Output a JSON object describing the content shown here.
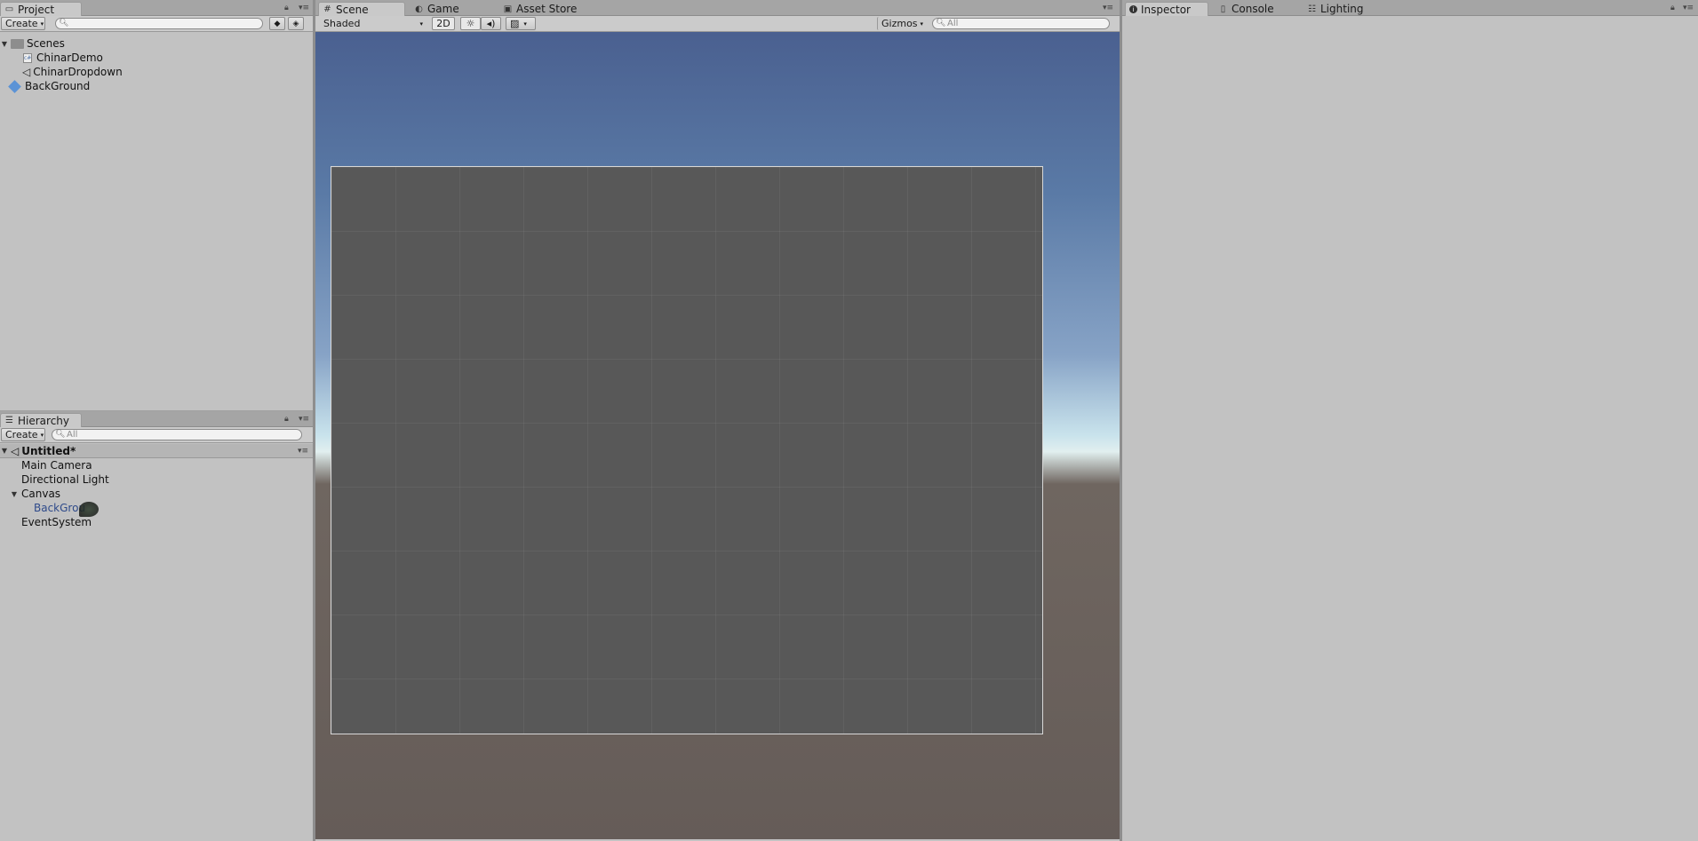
{
  "project": {
    "tab_label": "Project",
    "create_label": "Create",
    "items": [
      {
        "label": "Scenes",
        "icon": "folder-icon",
        "expanded": true
      },
      {
        "label": "ChinarDemo",
        "icon": "script-icon"
      },
      {
        "label": "ChinarDropdown",
        "icon": "unity-scene-icon"
      },
      {
        "label": "BackGround",
        "icon": "prefab-cube-icon"
      }
    ]
  },
  "hierarchy": {
    "tab_label": "Hierarchy",
    "create_label": "Create",
    "search_placeholder": "All",
    "scene_name": "Untitled*",
    "items": [
      {
        "label": "Main Camera"
      },
      {
        "label": "Directional Light"
      },
      {
        "label": "Canvas",
        "expanded": true
      },
      {
        "label": "BackGrou",
        "selected_color": "#2e4a8a"
      },
      {
        "label": "EventSystem"
      }
    ]
  },
  "scene": {
    "tabs": [
      {
        "label": "Scene",
        "icon": "grid-icon",
        "active": true
      },
      {
        "label": "Game",
        "icon": "pacman-icon"
      },
      {
        "label": "Asset Store",
        "icon": "bag-icon"
      }
    ],
    "shading_mode": "Shaded",
    "mode_2d": "2D",
    "gizmos_label": "Gizmos",
    "search_placeholder": "All"
  },
  "inspector": {
    "tabs": [
      {
        "label": "Inspector",
        "icon": "info-icon",
        "active": true
      },
      {
        "label": "Console",
        "icon": "console-icon"
      },
      {
        "label": "Lighting",
        "icon": "lighting-icon"
      }
    ]
  },
  "colors": {
    "panel_bg": "#c2c2c2",
    "canvas_gray": "#585858",
    "sky_top": "#4a6090",
    "ground": "#655c58"
  }
}
